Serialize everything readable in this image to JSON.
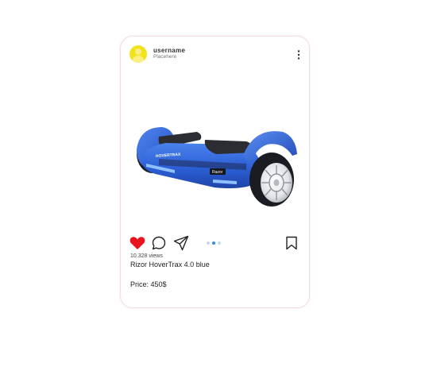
{
  "post": {
    "username": "username",
    "location": "Placehere",
    "views": "10.328 views",
    "caption": "Rizor HoverTrax 4.0 blue",
    "price": "Price: 450$",
    "product_brand_text": "HOVERTRAX",
    "product_logo_text": "Razor"
  },
  "icons": {
    "more": "more-vertical-icon",
    "like": "heart-icon",
    "comment": "comment-icon",
    "share": "send-icon",
    "save": "bookmark-icon"
  },
  "carousel": {
    "count": 3,
    "active_index": 1
  },
  "colors": {
    "avatar": "#f2e21b",
    "like_active": "#e8141c",
    "product_blue": "#2f62d8",
    "dot_active": "#3b8ed8",
    "dot_inactive": "#c7d6e6"
  }
}
